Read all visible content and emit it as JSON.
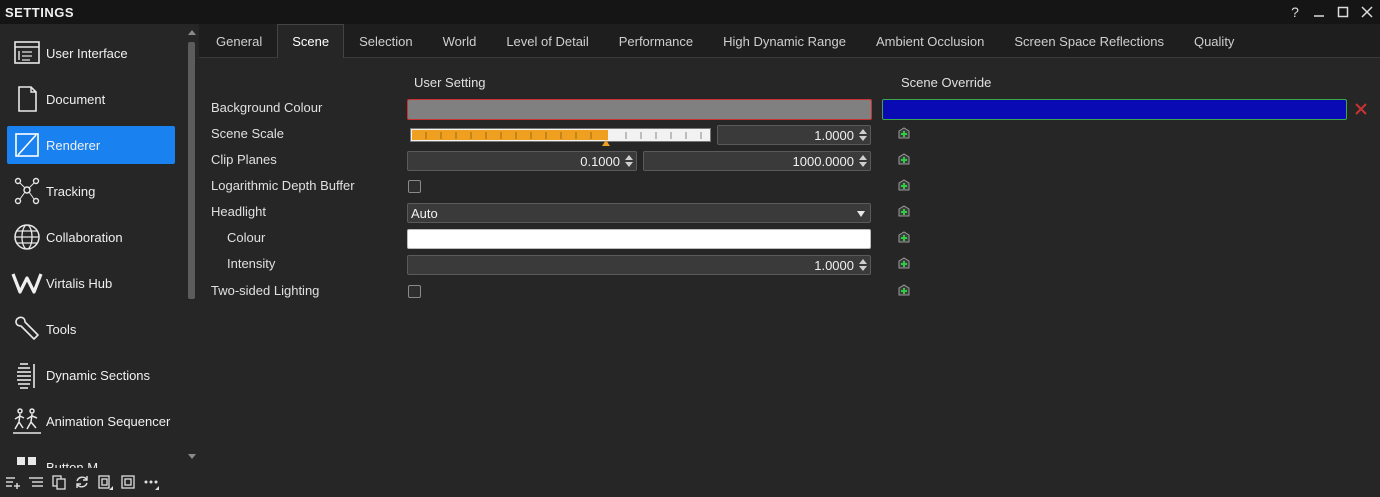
{
  "window": {
    "title": "SETTINGS",
    "help_glyph": "?",
    "minimize_glyph": "—",
    "maximize_glyph": "☐",
    "close_glyph": "✕"
  },
  "sidebar": {
    "items": [
      {
        "label": "User Interface",
        "icon": "user-interface-icon"
      },
      {
        "label": "Document",
        "icon": "document-icon"
      },
      {
        "label": "Renderer",
        "icon": "renderer-icon",
        "active": true
      },
      {
        "label": "Tracking",
        "icon": "tracking-icon"
      },
      {
        "label": "Collaboration",
        "icon": "globe-icon"
      },
      {
        "label": "Virtalis Hub",
        "icon": "virtalis-hub-icon"
      },
      {
        "label": "Tools",
        "icon": "wrench-icon"
      },
      {
        "label": "Dynamic Sections",
        "icon": "dynamic-sections-icon"
      },
      {
        "label": "Animation Sequencer",
        "icon": "animation-sequencer-icon"
      },
      {
        "label": "Button M",
        "icon": "button-mapping-icon"
      }
    ],
    "toolbar": [
      "add-item-icon",
      "add-list-icon",
      "copy-icon",
      "refresh-icon",
      "copy-page-icon",
      "frame-icon",
      "more-icon"
    ]
  },
  "tabs": [
    {
      "label": "General"
    },
    {
      "label": "Scene",
      "active": true
    },
    {
      "label": "Selection"
    },
    {
      "label": "World"
    },
    {
      "label": "Level of Detail"
    },
    {
      "label": "Performance"
    },
    {
      "label": "High Dynamic Range"
    },
    {
      "label": "Ambient Occlusion"
    },
    {
      "label": "Screen Space Reflections"
    },
    {
      "label": "Quality"
    }
  ],
  "columns": {
    "user_setting": "User Setting",
    "scene_override": "Scene Override"
  },
  "rows": {
    "background_colour": {
      "label": "Background Colour",
      "user_color": "#808080",
      "override_color": "#0a0ab4"
    },
    "scene_scale": {
      "label": "Scene Scale",
      "value": "1.0000",
      "slider_fraction": 0.66
    },
    "clip_planes": {
      "label": "Clip Planes",
      "near": "0.1000",
      "far": "1000.0000"
    },
    "log_depth": {
      "label": "Logarithmic Depth Buffer",
      "checked": false
    },
    "headlight": {
      "label": "Headlight",
      "value": "Auto"
    },
    "headlight_colour": {
      "label": "Colour",
      "color": "#ffffff"
    },
    "headlight_intensity": {
      "label": "Intensity",
      "value": "1.0000"
    },
    "two_sided": {
      "label": "Two-sided Lighting",
      "checked": false
    }
  },
  "colors": {
    "accent": "#1a82f0",
    "slider_fill": "#f0a020",
    "error_border": "#c83232",
    "override_border": "#3aa84a"
  }
}
